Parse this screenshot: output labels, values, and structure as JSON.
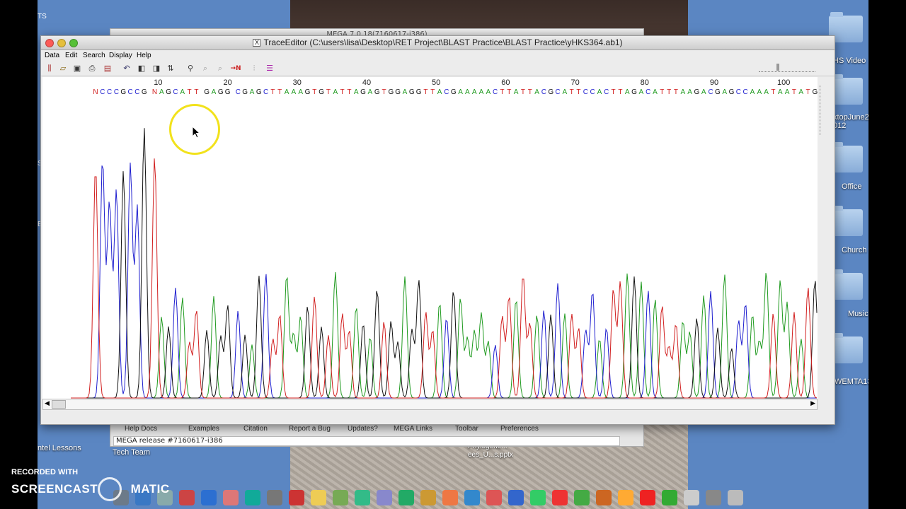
{
  "desktop": {
    "left_edge_labels": [
      "TS",
      "S",
      "E"
    ],
    "right_icons": [
      {
        "label": "HS Video"
      },
      {
        "label": "ktopJune2\n012"
      },
      {
        "label": "Office"
      },
      {
        "label": "Church"
      },
      {
        "label": "Music"
      },
      {
        "label": "WEMTA13"
      }
    ],
    "bottom_left_labels": [
      "ntel Lessons",
      "Tech Team"
    ],
    "bottom_file_label": "Phylogene...\nees_U...s.pptx"
  },
  "mega_window": {
    "title": "MEGA 7.0.18(7160617-i386)",
    "menu": [
      "Help Docs",
      "Examples",
      "Citation",
      "Report a Bug",
      "Updates?",
      "MEGA Links",
      "Toolbar",
      "Preferences"
    ],
    "status": "MEGA release #7160617-i386"
  },
  "trace_window": {
    "title": "TraceEditor (C:\\users\\lisa\\Desktop\\RET Project\\BLAST Practice\\BLAST Practice\\yHKS364.ab1)",
    "menu": [
      "Data",
      "Edit",
      "Search",
      "Display",
      "Help"
    ],
    "toolbar_icons": [
      "trace-icon",
      "open-icon",
      "save-icon",
      "print-icon",
      "export-icon",
      "undo-icon",
      "left-trim-icon",
      "right-trim-icon",
      "reverse-icon",
      "find-icon",
      "find-next-icon",
      "find-prev-icon",
      "find-n-icon",
      "mark-icon",
      "options-icon"
    ],
    "find_n_label": "→N",
    "ruler_positions": [
      "10",
      "20",
      "30",
      "40",
      "50",
      "60",
      "70",
      "80",
      "90",
      "100"
    ],
    "sequence": "NCCCGCCG NAGCATT GAGG CGAGCTTAAAGTGTATTAGAGTGGAGGTTACGAAAAACTTATTACGCATTCCACTTAGACATTTAAGACGAGCCAAATAATATGGCAC",
    "colors": {
      "A": "#1f9a1f",
      "C": "#1f1fcf",
      "G": "#111111",
      "T": "#d11f1f",
      "N": "#d11f1f"
    }
  },
  "watermark": {
    "recorded": "RECORDED WITH",
    "brand_left": "SCREENCAST",
    "brand_right": "MATIC"
  }
}
